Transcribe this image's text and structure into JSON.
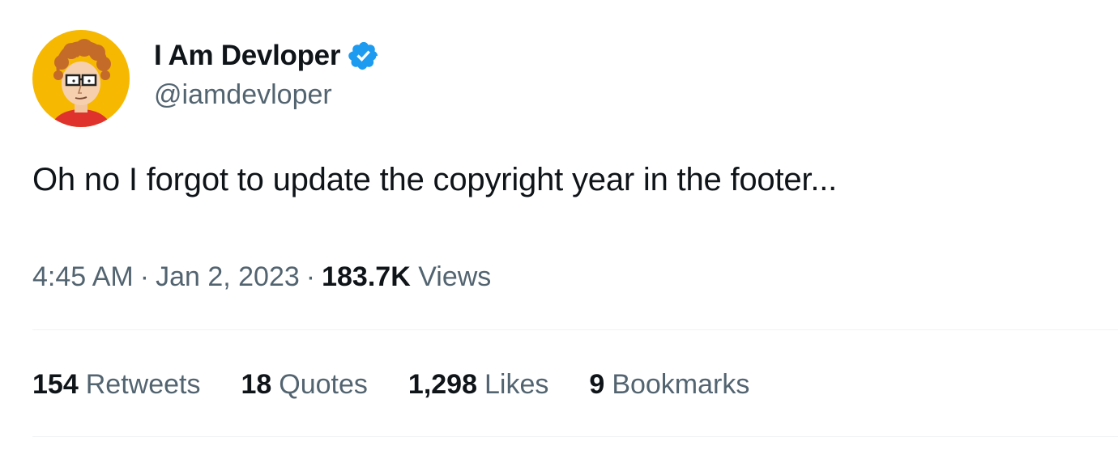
{
  "author": {
    "display_name": "I Am Devloper",
    "handle": "@iamdevloper",
    "verified": true,
    "avatar_icon": "cartoon-developer-avatar",
    "verified_icon": "verified-badge-icon",
    "verified_color": "#1d9bf0"
  },
  "tweet": {
    "text": "Oh no I forgot to update the copyright year in the footer..."
  },
  "meta": {
    "time": "4:45 AM",
    "separator": "·",
    "date": "Jan 2, 2023",
    "views_count": "183.7K",
    "views_label": "Views"
  },
  "stats": [
    {
      "count": "154",
      "label": "Retweets"
    },
    {
      "count": "18",
      "label": "Quotes"
    },
    {
      "count": "1,298",
      "label": "Likes"
    },
    {
      "count": "9",
      "label": "Bookmarks"
    }
  ],
  "colors": {
    "text_primary": "#0f1419",
    "text_secondary": "#536471",
    "divider": "#eff3f4",
    "avatar_background": "#f6b800"
  }
}
